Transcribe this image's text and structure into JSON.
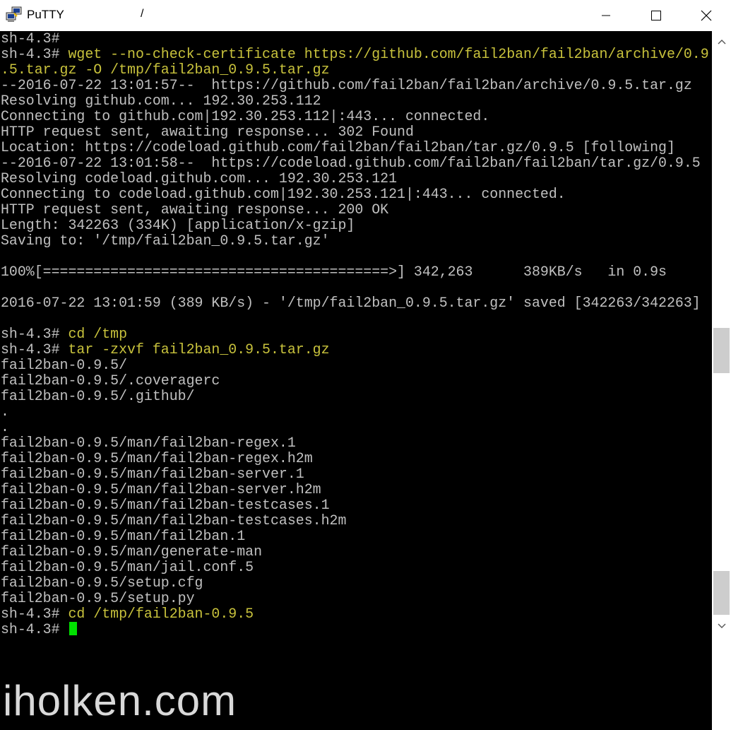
{
  "window": {
    "title": "PuTTY",
    "title_mark": "/",
    "icons": {
      "app": "putty-app-icon",
      "minimize": "minimize-icon",
      "maximize": "maximize-icon",
      "close": "close-icon"
    }
  },
  "terminal": {
    "prompt": "sh-4.3# ",
    "lines": [
      {
        "p": "sh-4.3#",
        "c": "",
        "o": ""
      },
      {
        "p": "sh-4.3# ",
        "c": "wget --no-check-certificate https://github.com/fail2ban/fail2ban/archive/0.9",
        "o": ""
      },
      {
        "p": "",
        "c": ".5.tar.gz -O /tmp/fail2ban_0.9.5.tar.gz",
        "o": ""
      },
      {
        "p": "",
        "c": "",
        "o": "--2016-07-22 13:01:57--  https://github.com/fail2ban/fail2ban/archive/0.9.5.tar.gz"
      },
      {
        "p": "",
        "c": "",
        "o": "Resolving github.com... 192.30.253.112"
      },
      {
        "p": "",
        "c": "",
        "o": "Connecting to github.com|192.30.253.112|:443... connected."
      },
      {
        "p": "",
        "c": "",
        "o": "HTTP request sent, awaiting response... 302 Found"
      },
      {
        "p": "",
        "c": "",
        "o": "Location: https://codeload.github.com/fail2ban/fail2ban/tar.gz/0.9.5 [following]"
      },
      {
        "p": "",
        "c": "",
        "o": "--2016-07-22 13:01:58--  https://codeload.github.com/fail2ban/fail2ban/tar.gz/0.9.5"
      },
      {
        "p": "",
        "c": "",
        "o": "Resolving codeload.github.com... 192.30.253.121"
      },
      {
        "p": "",
        "c": "",
        "o": "Connecting to codeload.github.com|192.30.253.121|:443... connected."
      },
      {
        "p": "",
        "c": "",
        "o": "HTTP request sent, awaiting response... 200 OK"
      },
      {
        "p": "",
        "c": "",
        "o": "Length: 342263 (334K) [application/x-gzip]"
      },
      {
        "p": "",
        "c": "",
        "o": "Saving to: '/tmp/fail2ban_0.9.5.tar.gz'"
      },
      {
        "p": "",
        "c": "",
        "o": ""
      },
      {
        "p": "",
        "c": "",
        "o": "100%[=========================================>] 342,263      389KB/s   in 0.9s"
      },
      {
        "p": "",
        "c": "",
        "o": ""
      },
      {
        "p": "",
        "c": "",
        "o": "2016-07-22 13:01:59 (389 KB/s) - '/tmp/fail2ban_0.9.5.tar.gz' saved [342263/342263]"
      },
      {
        "p": "",
        "c": "",
        "o": ""
      },
      {
        "p": "sh-4.3# ",
        "c": "cd /tmp",
        "o": ""
      },
      {
        "p": "sh-4.3# ",
        "c": "tar -zxvf fail2ban_0.9.5.tar.gz",
        "o": ""
      },
      {
        "p": "",
        "c": "",
        "o": "fail2ban-0.9.5/"
      },
      {
        "p": "",
        "c": "",
        "o": "fail2ban-0.9.5/.coveragerc"
      },
      {
        "p": "",
        "c": "",
        "o": "fail2ban-0.9.5/.github/"
      },
      {
        "p": "",
        "c": "",
        "o": "."
      },
      {
        "p": "",
        "c": "",
        "o": "."
      },
      {
        "p": "",
        "c": "",
        "o": "fail2ban-0.9.5/man/fail2ban-regex.1"
      },
      {
        "p": "",
        "c": "",
        "o": "fail2ban-0.9.5/man/fail2ban-regex.h2m"
      },
      {
        "p": "",
        "c": "",
        "o": "fail2ban-0.9.5/man/fail2ban-server.1"
      },
      {
        "p": "",
        "c": "",
        "o": "fail2ban-0.9.5/man/fail2ban-server.h2m"
      },
      {
        "p": "",
        "c": "",
        "o": "fail2ban-0.9.5/man/fail2ban-testcases.1"
      },
      {
        "p": "",
        "c": "",
        "o": "fail2ban-0.9.5/man/fail2ban-testcases.h2m"
      },
      {
        "p": "",
        "c": "",
        "o": "fail2ban-0.9.5/man/fail2ban.1"
      },
      {
        "p": "",
        "c": "",
        "o": "fail2ban-0.9.5/man/generate-man"
      },
      {
        "p": "",
        "c": "",
        "o": "fail2ban-0.9.5/man/jail.conf.5"
      },
      {
        "p": "",
        "c": "",
        "o": "fail2ban-0.9.5/setup.cfg"
      },
      {
        "p": "",
        "c": "",
        "o": "fail2ban-0.9.5/setup.py"
      },
      {
        "p": "sh-4.3# ",
        "c": "cd /tmp/fail2ban-0.9.5",
        "o": ""
      }
    ],
    "colors": {
      "background": "#000000",
      "output_text": "#c0c0c0",
      "command_text": "#c8c23c",
      "cursor": "#00e000"
    }
  },
  "scrollbar": {
    "icons": {
      "up": "scroll-up-arrow-icon",
      "down": "scroll-down-arrow-icon"
    }
  },
  "watermark": "iholken.com"
}
